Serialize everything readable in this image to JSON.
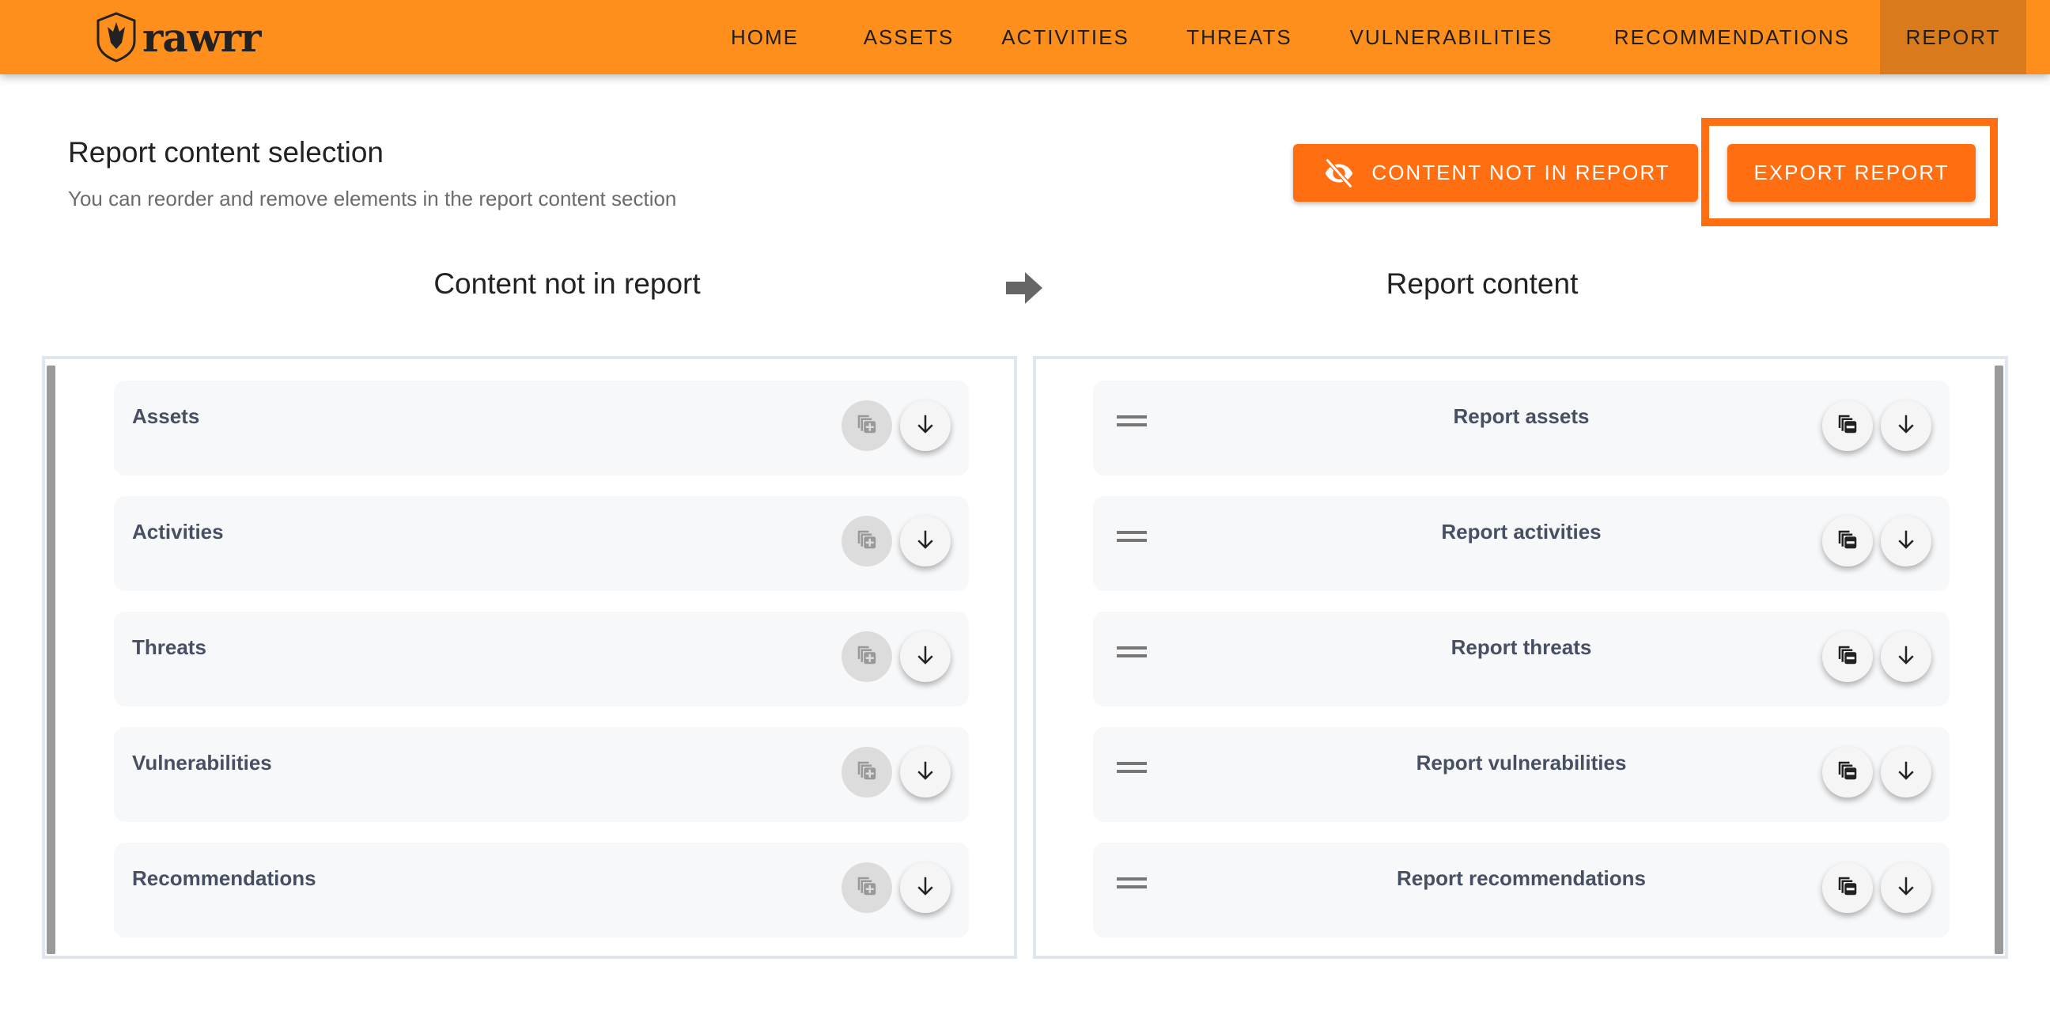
{
  "brand": {
    "name": "rawrr"
  },
  "nav": {
    "items": [
      {
        "label": "HOME"
      },
      {
        "label": "ASSETS"
      },
      {
        "label": "ACTIVITIES"
      },
      {
        "label": "THREATS"
      },
      {
        "label": "VULNERABILITIES"
      },
      {
        "label": "RECOMMENDATIONS"
      },
      {
        "label": "REPORT",
        "active": true
      }
    ]
  },
  "header": {
    "title": "Report content selection",
    "subtitle": "You can reorder and remove elements in the report content section"
  },
  "actions": {
    "content_not_in_report": "CONTENT NOT IN REPORT",
    "export_report": "EXPORT REPORT"
  },
  "left": {
    "title": "Content not in report",
    "items": [
      {
        "label": "Assets"
      },
      {
        "label": "Activities"
      },
      {
        "label": "Threats"
      },
      {
        "label": "Vulnerabilities"
      },
      {
        "label": "Recommendations"
      }
    ]
  },
  "right": {
    "title": "Report content",
    "items": [
      {
        "label": "Report assets"
      },
      {
        "label": "Report activities"
      },
      {
        "label": "Report threats"
      },
      {
        "label": "Report vulnerabilities"
      },
      {
        "label": "Report recommendations"
      }
    ]
  },
  "colors": {
    "nav": "#FF8F1C",
    "nav_active": "#D97A1C",
    "accent": "#FF6F12"
  }
}
